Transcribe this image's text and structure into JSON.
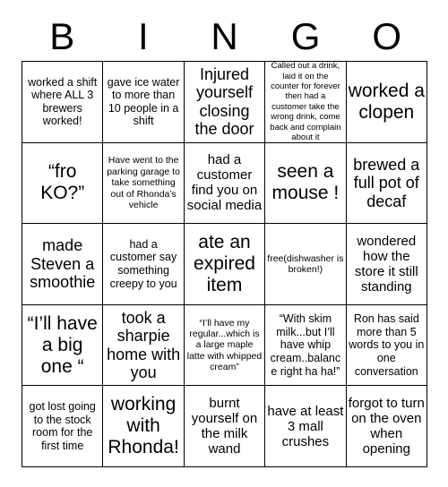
{
  "header": {
    "letters": [
      "B",
      "I",
      "N",
      "G",
      "O"
    ]
  },
  "colors": {
    "border": "#000000",
    "background": "#ffffff",
    "text": "#000000"
  },
  "grid": {
    "rows": [
      [
        {
          "text": "worked a shift where ALL 3 brewers worked!",
          "size": "fs-sm"
        },
        {
          "text": "gave ice water to more than 10 people in a shift",
          "size": "fs-sm"
        },
        {
          "text": "Injured yourself closing the door",
          "size": "fs-lg"
        },
        {
          "text": "Called out a drink, laid it on the counter for forever then had a customer take the wrong drink, come back and complain about it",
          "size": "fs-xxs"
        },
        {
          "text": "worked a clopen",
          "size": "fs-xl"
        }
      ],
      [
        {
          "text": "“fro KO?”",
          "size": "fs-xl"
        },
        {
          "text": "Have went to the parking garage to take something out of Rhonda’s vehicle",
          "size": "fs-xs"
        },
        {
          "text": "had a customer find you on social media",
          "size": "fs-md"
        },
        {
          "text": "seen a mouse !",
          "size": "fs-xl"
        },
        {
          "text": "brewed a full pot of decaf",
          "size": "fs-lg"
        }
      ],
      [
        {
          "text": "made Steven a smoothie",
          "size": "fs-lg"
        },
        {
          "text": "had a customer say something creepy to you",
          "size": "fs-sm"
        },
        {
          "text": "ate an expired item",
          "size": "fs-xl"
        },
        {
          "text": "free(dishwasher is broken!)",
          "size": "fs-xs"
        },
        {
          "text": "wondered how the store it still standing",
          "size": "fs-md"
        }
      ],
      [
        {
          "text": "“I’ll have a big one “",
          "size": "fs-xl"
        },
        {
          "text": "took a sharpie home with you",
          "size": "fs-lg"
        },
        {
          "text": "“I’ll have my regular...which is a large maple latte with whipped cream”",
          "size": "fs-xs"
        },
        {
          "text": "“With skim milk...but I’ll have whip cream..balance right ha ha!”",
          "size": "fs-sm"
        },
        {
          "text": "Ron has said more than 5 words to you in one conversation",
          "size": "fs-sm"
        }
      ],
      [
        {
          "text": "got lost going to the stock room for the first time",
          "size": "fs-sm"
        },
        {
          "text": "working with Rhonda!",
          "size": "fs-xl"
        },
        {
          "text": "burnt yourself on the milk wand",
          "size": "fs-md"
        },
        {
          "text": "have at least 3 mall crushes",
          "size": "fs-md"
        },
        {
          "text": "forgot to turn on the oven when opening",
          "size": "fs-md"
        }
      ]
    ]
  }
}
